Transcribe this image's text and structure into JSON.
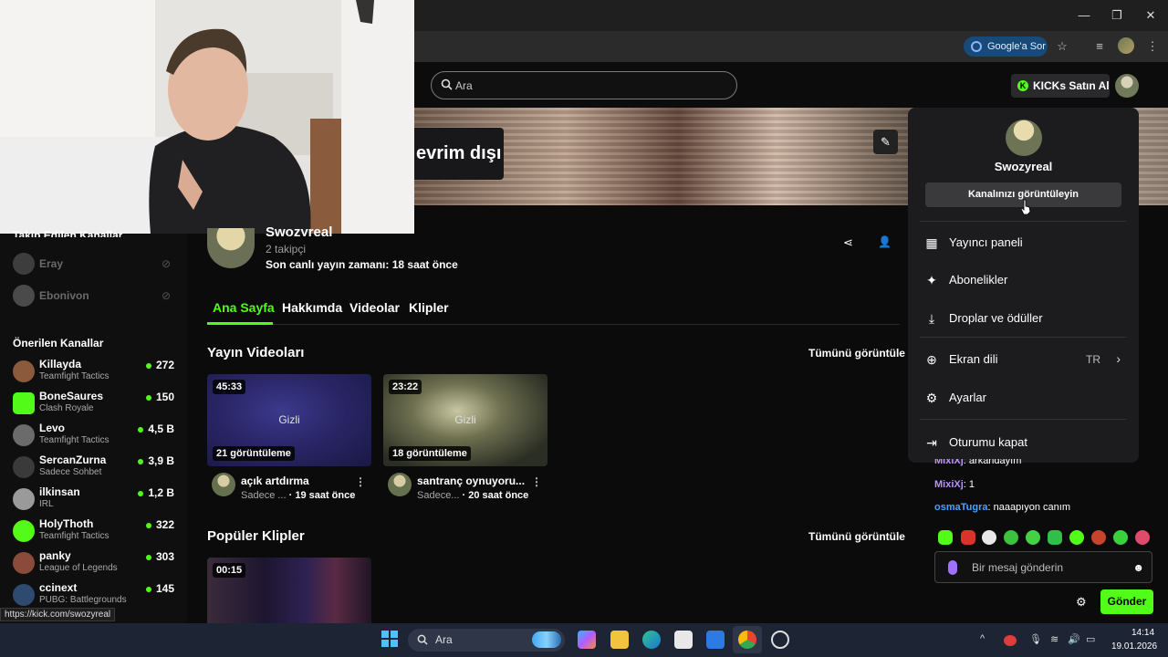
{
  "browser": {
    "window_controls": {
      "minimize": "—",
      "maximize": "❐",
      "close": "✕"
    },
    "google_ask_label": "Google'a Sor",
    "star_icon": "☆"
  },
  "header": {
    "search_placeholder": "Ara",
    "kicks_label": "KICKs Satın Al"
  },
  "banner": {
    "offline_text": "evrim dışı"
  },
  "sidebar": {
    "followed_heading": "Takip Edilen Kanallar",
    "followed": [
      {
        "name": "Eray"
      },
      {
        "name": "Ebonivon"
      }
    ],
    "recommended_heading": "Önerilen Kanallar",
    "recommended": [
      {
        "name": "Killayda",
        "game": "Teamfight Tactics",
        "viewers": "272",
        "color": "#8b5a3c"
      },
      {
        "name": "BoneSaures",
        "game": "Clash Royale",
        "viewers": "150",
        "color": "#53fc18"
      },
      {
        "name": "Levo",
        "game": "Teamfight Tactics",
        "viewers": "4,5 B",
        "color": "#6b6b6b"
      },
      {
        "name": "SercanZurna",
        "game": "Sadece Sohbet",
        "viewers": "3,9 B",
        "color": "#3a3a3a"
      },
      {
        "name": "ilkinsan",
        "game": "IRL",
        "viewers": "1,2 B",
        "color": "#9a9a9a"
      },
      {
        "name": "HolyThoth",
        "game": "Teamfight Tactics",
        "viewers": "322",
        "color": "#53fc18"
      },
      {
        "name": "panky",
        "game": "League of Legends",
        "viewers": "303",
        "color": "#8a4b3a"
      },
      {
        "name": "ccinext",
        "game": "PUBG: Battlegrounds",
        "viewers": "145",
        "color": "#2e4a6e"
      }
    ]
  },
  "profile": {
    "name": "Swozyreal",
    "followers": "2 takipçi",
    "last_live": "Son canlı yayın zamanı: 18 saat önce"
  },
  "tabs": [
    "Ana Sayfa",
    "Hakkımda",
    "Videolar",
    "Klipler"
  ],
  "videos_section": {
    "heading": "Yayın Videoları",
    "see_all": "Tümünü görüntüle",
    "items": [
      {
        "duration": "45:33",
        "views": "21 görüntüleme",
        "privacy": "Gizli",
        "title": "açık artdırma",
        "meta_prefix": "Sadece ...",
        "meta_time": " · 19 saat önce"
      },
      {
        "duration": "23:22",
        "views": "18 görüntüleme",
        "privacy": "Gizli",
        "title": "santranç oynuyoru...",
        "meta_prefix": "Sadece...",
        "meta_time": " · 20 saat önce"
      }
    ]
  },
  "clips_section": {
    "heading": "Popüler Klipler",
    "see_all": "Tümünü görüntüle",
    "clip_duration": "00:15"
  },
  "menu": {
    "user_name": "Swozyreal",
    "view_channel": "Kanalınızı görüntüleyin",
    "items": [
      {
        "label": "Yayıncı paneli",
        "icon": "dashboard-icon"
      },
      {
        "label": "Abonelikler",
        "icon": "sparkle-icon"
      },
      {
        "label": "Droplar ve ödüller",
        "icon": "drops-icon"
      },
      {
        "label": "Ekran dili",
        "icon": "globe-icon",
        "value": "TR"
      },
      {
        "label": "Ayarlar",
        "icon": "gear-icon"
      },
      {
        "label": "Oturumu kapat",
        "icon": "logout-icon"
      }
    ]
  },
  "chat": {
    "lines": [
      {
        "user": "MixiXj",
        "text": ": arkandayım"
      },
      {
        "user": "MixiXj",
        "text": ": 1"
      },
      {
        "user": "osmaTugra",
        "text": ": naaapıyon canım"
      }
    ],
    "input_placeholder": "Bir mesaj gönderin",
    "send_label": "Gönder"
  },
  "status_url": "https://kick.com/swozyreal",
  "taskbar": {
    "search_label": "Ara",
    "time": "14:14",
    "date": "19.01.2026"
  },
  "colors": {
    "accent": "#53fc18",
    "menu_bg": "#1c1c1e",
    "page_bg": "#0b0b0c"
  }
}
